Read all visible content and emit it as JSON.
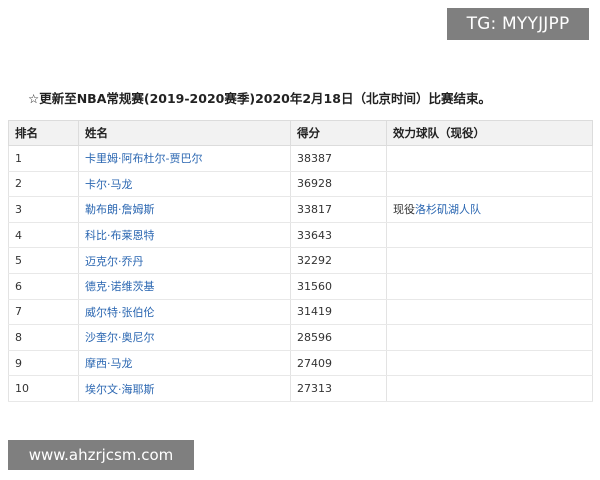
{
  "watermark_top": "TG: MYYJJPP",
  "notice": "☆更新至NBA常规赛(2019-2020赛季)2020年2月18日（北京时间）比赛结束。",
  "table": {
    "headers": {
      "rank": "排名",
      "name": "姓名",
      "points": "得分",
      "team": "效力球队（现役）"
    },
    "rows": [
      {
        "rank": "1",
        "name": "卡里姆·阿布杜尔-贾巴尔",
        "points": "38387",
        "team_prefix": "",
        "team": ""
      },
      {
        "rank": "2",
        "name": "卡尔·马龙",
        "points": "36928",
        "team_prefix": "",
        "team": ""
      },
      {
        "rank": "3",
        "name": "勒布朗·詹姆斯",
        "points": "33817",
        "team_prefix": "现役",
        "team": "洛杉矶湖人队"
      },
      {
        "rank": "4",
        "name": "科比·布莱恩特",
        "points": "33643",
        "team_prefix": "",
        "team": ""
      },
      {
        "rank": "5",
        "name": "迈克尔·乔丹",
        "points": "32292",
        "team_prefix": "",
        "team": ""
      },
      {
        "rank": "6",
        "name": "德克·诺维茨基",
        "points": "31560",
        "team_prefix": "",
        "team": ""
      },
      {
        "rank": "7",
        "name": "威尔特·张伯伦",
        "points": "31419",
        "team_prefix": "",
        "team": ""
      },
      {
        "rank": "8",
        "name": "沙奎尔·奥尼尔",
        "points": "28596",
        "team_prefix": "",
        "team": ""
      },
      {
        "rank": "9",
        "name": "摩西·马龙",
        "points": "27409",
        "team_prefix": "",
        "team": ""
      },
      {
        "rank": "10",
        "name": "埃尔文·海耶斯",
        "points": "27313",
        "team_prefix": "",
        "team": ""
      }
    ]
  },
  "watermark_bottom": "www.ahzrjcsm.com"
}
